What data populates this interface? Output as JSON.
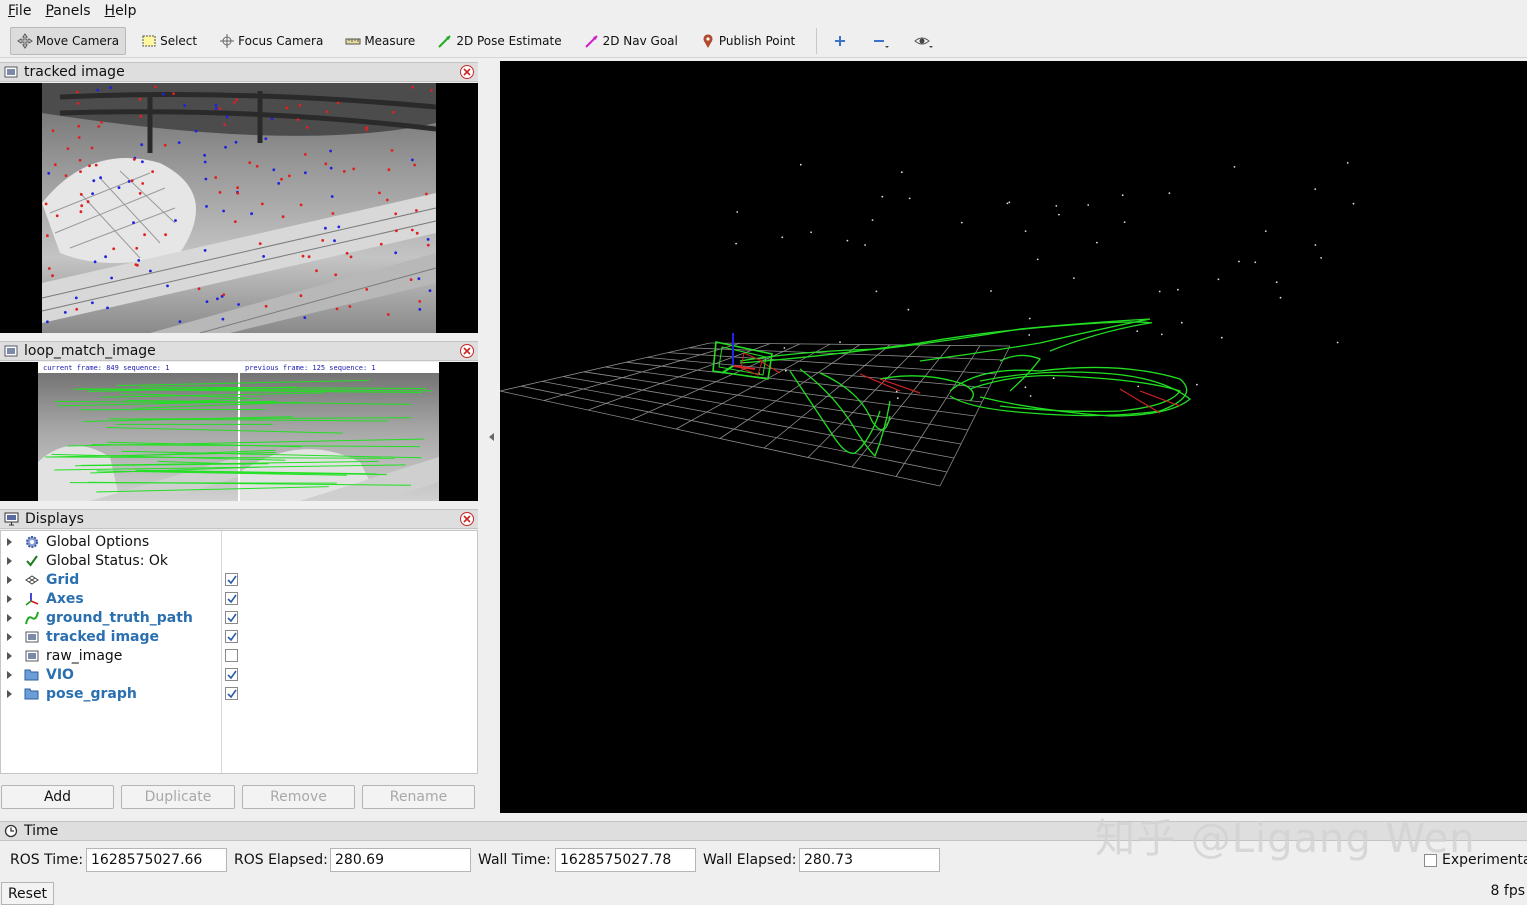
{
  "menu": [
    {
      "label": "File",
      "mnemonic": "F",
      "rest": "ile"
    },
    {
      "label": "Panels",
      "mnemonic": "P",
      "rest": "anels"
    },
    {
      "label": "Help",
      "mnemonic": "H",
      "rest": "elp"
    }
  ],
  "toolbar": {
    "move_camera": "Move Camera",
    "select": "Select",
    "focus_camera": "Focus Camera",
    "measure": "Measure",
    "pose_estimate": "2D Pose Estimate",
    "nav_goal": "2D Nav Goal",
    "publish_point": "Publish Point"
  },
  "panels": {
    "tracked_image": {
      "title": "tracked image"
    },
    "loop_match_image": {
      "title": "loop_match_image",
      "left_caption": "current frame: 849   sequence: 1",
      "right_caption": "previous frame: 125   sequence: 1"
    },
    "displays": {
      "title": "Displays"
    }
  },
  "displays": [
    {
      "label": "Global Options",
      "icon": "gear-icon",
      "checkbox": null,
      "highlight": false
    },
    {
      "label": "Global Status: Ok",
      "icon": "checkmark-icon",
      "checkbox": null,
      "highlight": false
    },
    {
      "label": "Grid",
      "icon": "grid-icon",
      "checkbox": true,
      "highlight": true
    },
    {
      "label": "Axes",
      "icon": "axes-icon",
      "checkbox": true,
      "highlight": true
    },
    {
      "label": "ground_truth_path",
      "icon": "path-icon",
      "checkbox": true,
      "highlight": true
    },
    {
      "label": "tracked image",
      "icon": "image-icon",
      "checkbox": true,
      "highlight": true
    },
    {
      "label": "raw_image",
      "icon": "image-icon",
      "checkbox": false,
      "highlight": false
    },
    {
      "label": "VIO",
      "icon": "folder-icon",
      "checkbox": true,
      "highlight": true
    },
    {
      "label": "pose_graph",
      "icon": "folder-icon",
      "checkbox": true,
      "highlight": true
    }
  ],
  "buttons": {
    "add": "Add",
    "duplicate": "Duplicate",
    "remove": "Remove",
    "rename": "Rename"
  },
  "time": {
    "title": "Time",
    "ros_time_label": "ROS Time:",
    "ros_time": "1628575027.66",
    "ros_elapsed_label": "ROS Elapsed:",
    "ros_elapsed": "280.69",
    "wall_time_label": "Wall Time:",
    "wall_time": "1628575027.78",
    "wall_elapsed_label": "Wall Elapsed:",
    "wall_elapsed": "280.73",
    "experimental_label": "Experimenta",
    "reset": "Reset",
    "fps": "8 fps"
  },
  "watermark": "知乎 @Ligang Wen",
  "colors": {
    "highlight_text": "#2a6fb0",
    "trajectory": "#22dd22",
    "loop_edge": "#cc2222",
    "grid_line": "#8c8c8c",
    "close_button": "#c62828"
  }
}
